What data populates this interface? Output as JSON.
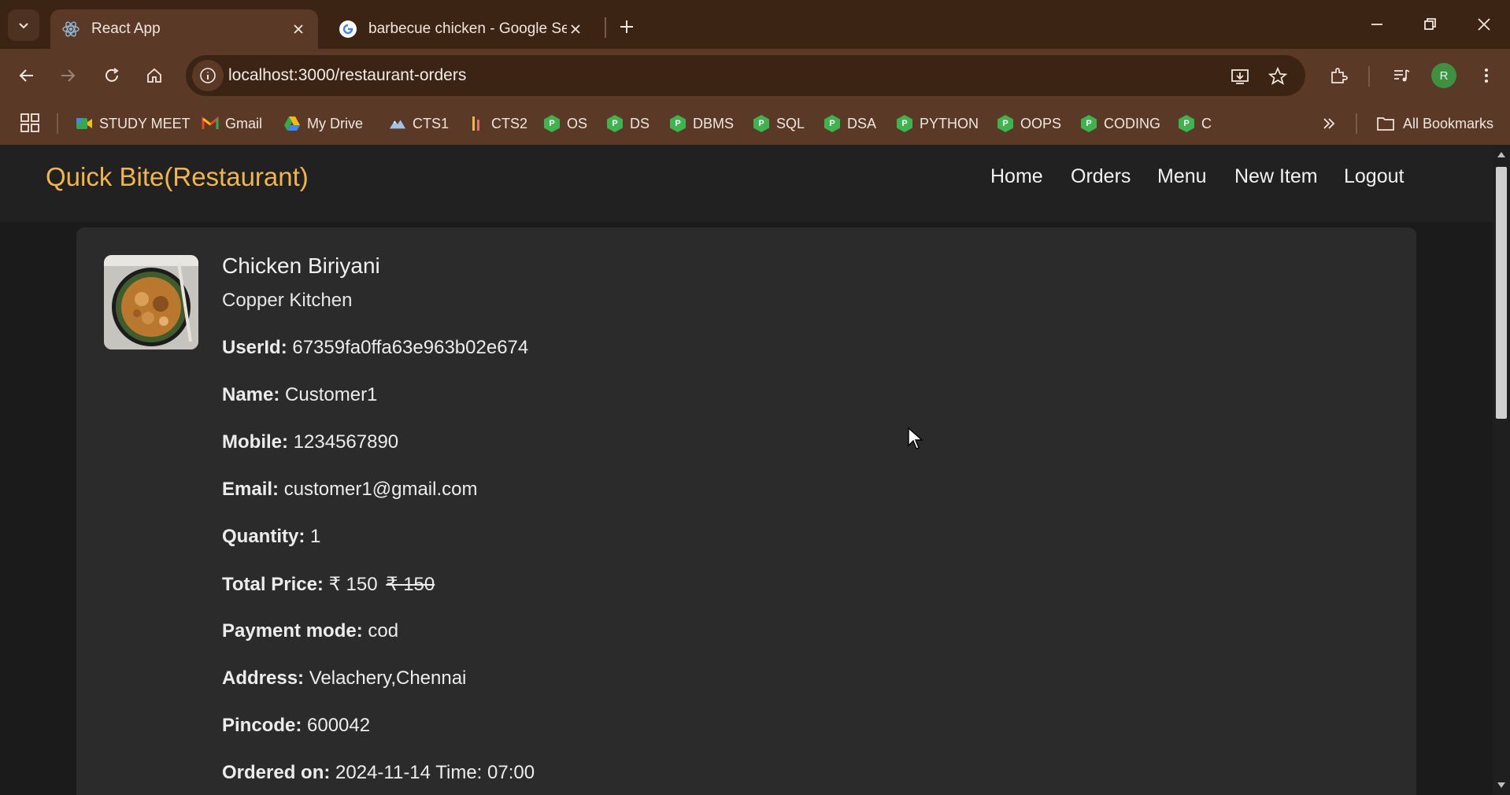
{
  "browser": {
    "tabs": [
      {
        "title": "React App",
        "active": true
      },
      {
        "title": "barbecue chicken - Google Sea",
        "active": false
      }
    ],
    "url": "localhost:3000/restaurant-orders",
    "profile_initial": "R",
    "bookmarks": [
      "STUDY MEET",
      "Gmail",
      "My Drive",
      "CTS1",
      "CTS2",
      "OS",
      "DS",
      "DBMS",
      "SQL",
      "DSA",
      "PYTHON",
      "OOPS",
      "CODING",
      "C"
    ],
    "all_bookmarks_label": "All Bookmarks"
  },
  "navbar": {
    "brand": "Quick Bite(Restaurant)",
    "links": [
      "Home",
      "Orders",
      "Menu",
      "New Item",
      "Logout"
    ]
  },
  "order": {
    "item_name": "Chicken Biriyani",
    "restaurant": "Copper Kitchen",
    "fields": [
      {
        "label": "UserId:",
        "value": "67359fa0ffa63e963b02e674"
      },
      {
        "label": "Name:",
        "value": "Customer1"
      },
      {
        "label": "Mobile:",
        "value": "1234567890"
      },
      {
        "label": "Email:",
        "value": "customer1@gmail.com"
      },
      {
        "label": "Quantity:",
        "value": "1"
      },
      {
        "label": "Total Price:",
        "value": "₹ 150",
        "struck": "₹ 150"
      },
      {
        "label": "Payment mode:",
        "value": "cod"
      },
      {
        "label": "Address:",
        "value": "Velachery,Chennai"
      },
      {
        "label": "Pincode:",
        "value": "600042"
      },
      {
        "label": "Ordered on:",
        "value": "2024-11-14 Time: 07:00"
      }
    ]
  },
  "colors": {
    "brand": "#f0b64c",
    "chrome_dark": "#3b2414",
    "chrome": "#5a3a26",
    "page_bg": "#1b1b1b",
    "card_bg": "#2b2b2b"
  }
}
